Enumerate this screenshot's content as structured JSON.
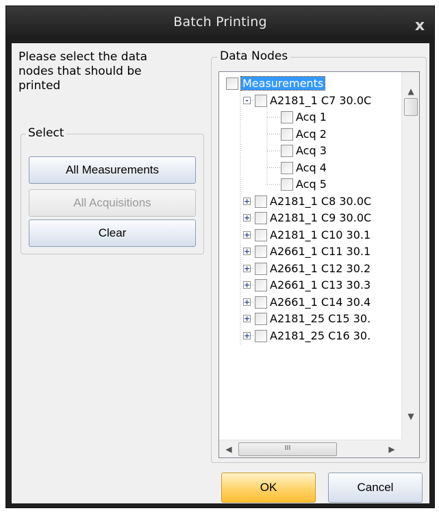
{
  "window": {
    "title": "Batch Printing",
    "close_glyph": "x"
  },
  "intro": {
    "text": "Please select the data nodes that should be printed"
  },
  "select_group": {
    "legend": "Select",
    "buttons": {
      "all_measurements": "All Measurements",
      "all_acquisitions": "All Acquisitions",
      "clear": "Clear"
    }
  },
  "data_nodes": {
    "legend": "Data Nodes",
    "root": {
      "label": "Measurements",
      "checked": false,
      "selected": true
    },
    "expanded_node": {
      "label": "A2181_1 C7 30.0C",
      "expander": "-",
      "children": [
        "Acq 1",
        "Acq 2",
        "Acq 3",
        "Acq 4",
        "Acq 5"
      ]
    },
    "collapsed_nodes": [
      "A2181_1 C8 30.0C",
      "A2181_1 C9 30.0C",
      "A2181_1 C10 30.1",
      "A2661_1 C11 30.1",
      "A2661_1 C12 30.2",
      "A2661_1 C13 30.3",
      "A2661_1 C14 30.4",
      "A2181_25 C15 30.",
      "A2181_25 C16 30."
    ],
    "collapsed_expander": "+",
    "scroll": {
      "up": "▲",
      "down": "▼",
      "left": "◀",
      "right": "▶",
      "grip": "III"
    }
  },
  "footer": {
    "ok": "OK",
    "cancel": "Cancel"
  },
  "colors": {
    "title_bar": "#262626",
    "selection": "#3399ff",
    "ok_button": "#ffd36a"
  },
  "icons": [
    "close-icon",
    "checkbox-icon",
    "expand-icon",
    "collapse-icon",
    "scroll-arrow-icon"
  ]
}
